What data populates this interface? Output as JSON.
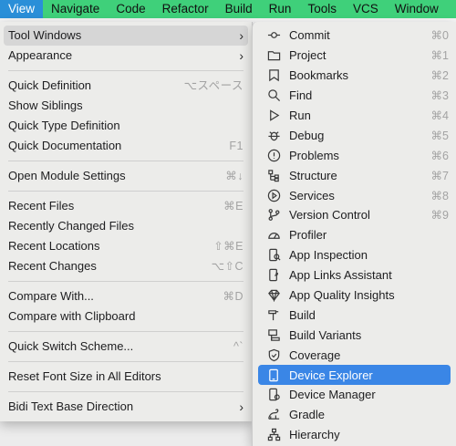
{
  "menubar": {
    "items": [
      "View",
      "Navigate",
      "Code",
      "Refactor",
      "Build",
      "Run",
      "Tools",
      "VCS",
      "Window"
    ],
    "active": "View"
  },
  "view_menu": {
    "items": [
      {
        "label": "Tool Windows",
        "shortcut": "",
        "submenu": true,
        "highlighted": true
      },
      {
        "label": "Appearance",
        "shortcut": "",
        "submenu": true
      },
      {
        "sep": true
      },
      {
        "label": "Quick Definition",
        "shortcut": "⌥スペース"
      },
      {
        "label": "Show Siblings",
        "shortcut": ""
      },
      {
        "label": "Quick Type Definition",
        "shortcut": ""
      },
      {
        "label": "Quick Documentation",
        "shortcut": "F1"
      },
      {
        "sep": true
      },
      {
        "label": "Open Module Settings",
        "shortcut": "⌘↓"
      },
      {
        "sep": true
      },
      {
        "label": "Recent Files",
        "shortcut": "⌘E"
      },
      {
        "label": "Recently Changed Files",
        "shortcut": ""
      },
      {
        "label": "Recent Locations",
        "shortcut": "⇧⌘E"
      },
      {
        "label": "Recent Changes",
        "shortcut": "⌥⇧C"
      },
      {
        "sep": true
      },
      {
        "label": "Compare With...",
        "shortcut": "⌘D"
      },
      {
        "label": "Compare with Clipboard",
        "shortcut": ""
      },
      {
        "sep": true
      },
      {
        "label": "Quick Switch Scheme...",
        "shortcut": "^`"
      },
      {
        "sep": true
      },
      {
        "label": "Reset Font Size in All Editors",
        "shortcut": ""
      },
      {
        "sep": true
      },
      {
        "label": "Bidi Text Base Direction",
        "shortcut": "",
        "submenu": true
      }
    ]
  },
  "tool_windows": {
    "items": [
      {
        "label": "Commit",
        "shortcut": "⌘0",
        "icon": "commit-icon"
      },
      {
        "label": "Project",
        "shortcut": "⌘1",
        "icon": "folder-icon"
      },
      {
        "label": "Bookmarks",
        "shortcut": "⌘2",
        "icon": "bookmark-icon"
      },
      {
        "label": "Find",
        "shortcut": "⌘3",
        "icon": "search-icon"
      },
      {
        "label": "Run",
        "shortcut": "⌘4",
        "icon": "play-icon"
      },
      {
        "label": "Debug",
        "shortcut": "⌘5",
        "icon": "bug-icon"
      },
      {
        "label": "Problems",
        "shortcut": "⌘6",
        "icon": "warning-icon"
      },
      {
        "label": "Structure",
        "shortcut": "⌘7",
        "icon": "structure-icon"
      },
      {
        "label": "Services",
        "shortcut": "⌘8",
        "icon": "services-icon"
      },
      {
        "label": "Version Control",
        "shortcut": "⌘9",
        "icon": "branch-icon"
      },
      {
        "label": "Profiler",
        "shortcut": "",
        "icon": "gauge-icon"
      },
      {
        "label": "App Inspection",
        "shortcut": "",
        "icon": "inspect-icon"
      },
      {
        "label": "App Links Assistant",
        "shortcut": "",
        "icon": "link-icon"
      },
      {
        "label": "App Quality Insights",
        "shortcut": "",
        "icon": "diamond-icon"
      },
      {
        "label": "Build",
        "shortcut": "",
        "icon": "hammer-icon"
      },
      {
        "label": "Build Variants",
        "shortcut": "",
        "icon": "variants-icon"
      },
      {
        "label": "Coverage",
        "shortcut": "",
        "icon": "shield-icon"
      },
      {
        "label": "Device Explorer",
        "shortcut": "",
        "icon": "device-icon",
        "selected": true
      },
      {
        "label": "Device Manager",
        "shortcut": "",
        "icon": "device-manager-icon"
      },
      {
        "label": "Gradle",
        "shortcut": "",
        "icon": "gradle-icon"
      },
      {
        "label": "Hierarchy",
        "shortcut": "",
        "icon": "hierarchy-icon"
      }
    ]
  }
}
